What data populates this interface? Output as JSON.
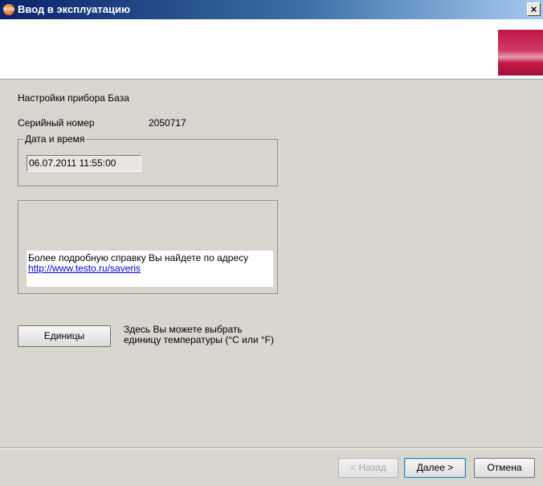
{
  "window": {
    "title": "Ввод в эксплуатацию",
    "close_glyph": "×",
    "app_icon_text": "testo"
  },
  "settings": {
    "device_settings_label": "Настройки прибора База",
    "serial_label": "Серийный номер",
    "serial_value": "2050717"
  },
  "datetime": {
    "legend": "Дата и время",
    "value": "06.07.2011 11:55:00"
  },
  "info": {
    "text": "Более подробную справку Вы найдете по адресу",
    "link": "http://www.testo.ru/saveris"
  },
  "units": {
    "button_label": "Единицы",
    "description_line1": "Здесь Вы можете выбрать",
    "description_line2": "единицу температуры (°C или °F)"
  },
  "footer": {
    "back_label": "< Назад",
    "next_label": "Далее >",
    "cancel_label": "Отмена"
  },
  "colors": {
    "title_gradient_start": "#0a246a",
    "dialog_background": "#d9d5cf",
    "logo_accent": "#c2154a",
    "link": "#0000ee"
  }
}
